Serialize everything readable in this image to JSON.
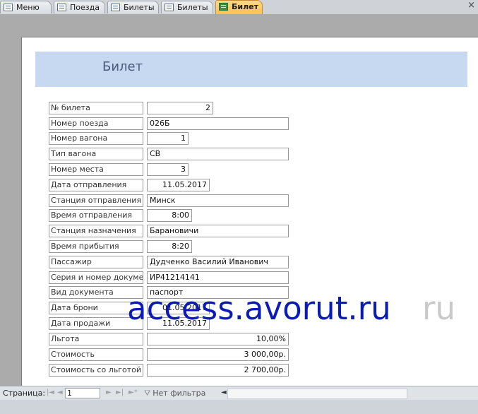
{
  "tabs": [
    {
      "label": "Меню",
      "icon": "form-icon",
      "active": false
    },
    {
      "label": "Поезда",
      "icon": "form-icon",
      "active": false
    },
    {
      "label": "Билеты",
      "icon": "form-icon",
      "active": false
    },
    {
      "label": "Билеты",
      "icon": "form-icon",
      "active": false
    },
    {
      "label": "Билет",
      "icon": "report-icon",
      "active": true
    }
  ],
  "close_label": "×",
  "report": {
    "title": "Билет",
    "fields": [
      {
        "label": "№ билета",
        "value": "2"
      },
      {
        "label": "Номер поезда",
        "value": "026Б"
      },
      {
        "label": "Номер вагона",
        "value": "1"
      },
      {
        "label": "Тип вагона",
        "value": "СВ"
      },
      {
        "label": "Номер места",
        "value": "3"
      },
      {
        "label": "Дата отправления",
        "value": "11.05.2017"
      },
      {
        "label": "Станция отправления",
        "value": "Минск"
      },
      {
        "label": "Время отправления",
        "value": "8:00"
      },
      {
        "label": "Станция назначения",
        "value": "Барановичи"
      },
      {
        "label": "Время прибытия",
        "value": "8:20"
      },
      {
        "label": "Пассажир",
        "value": "Дудченко Василий Иванович"
      },
      {
        "label": "Серия и номер документ",
        "value": "ИР41214141"
      },
      {
        "label": "Вид документа",
        "value": "паспорт"
      },
      {
        "label": "Дата брони",
        "value": "01.05.2017"
      },
      {
        "label": "Дата продажи",
        "value": "11.05.2017"
      },
      {
        "label": "Льгота",
        "value": "10,00%"
      },
      {
        "label": "Стоимость",
        "value": "3 000,00р."
      },
      {
        "label": "Стоимость со льготой",
        "value": "2 700,00р."
      }
    ]
  },
  "watermark": {
    "text": "access.avorut.ru",
    "ghost": "ru"
  },
  "navigation": {
    "page_label": "Страница:",
    "first_icon": "first-record-icon",
    "prev_icon": "prev-record-icon",
    "page_value": "1",
    "next_icon": "next-record-icon",
    "last_icon": "last-record-icon",
    "new_icon": "new-record-icon",
    "filter_icon": "filter-icon",
    "filter_label": "Нет фильтра"
  },
  "colors": {
    "header_band": "#c6d9f1",
    "active_tab": "#ffc24d",
    "watermark": "#0b1bb8"
  }
}
